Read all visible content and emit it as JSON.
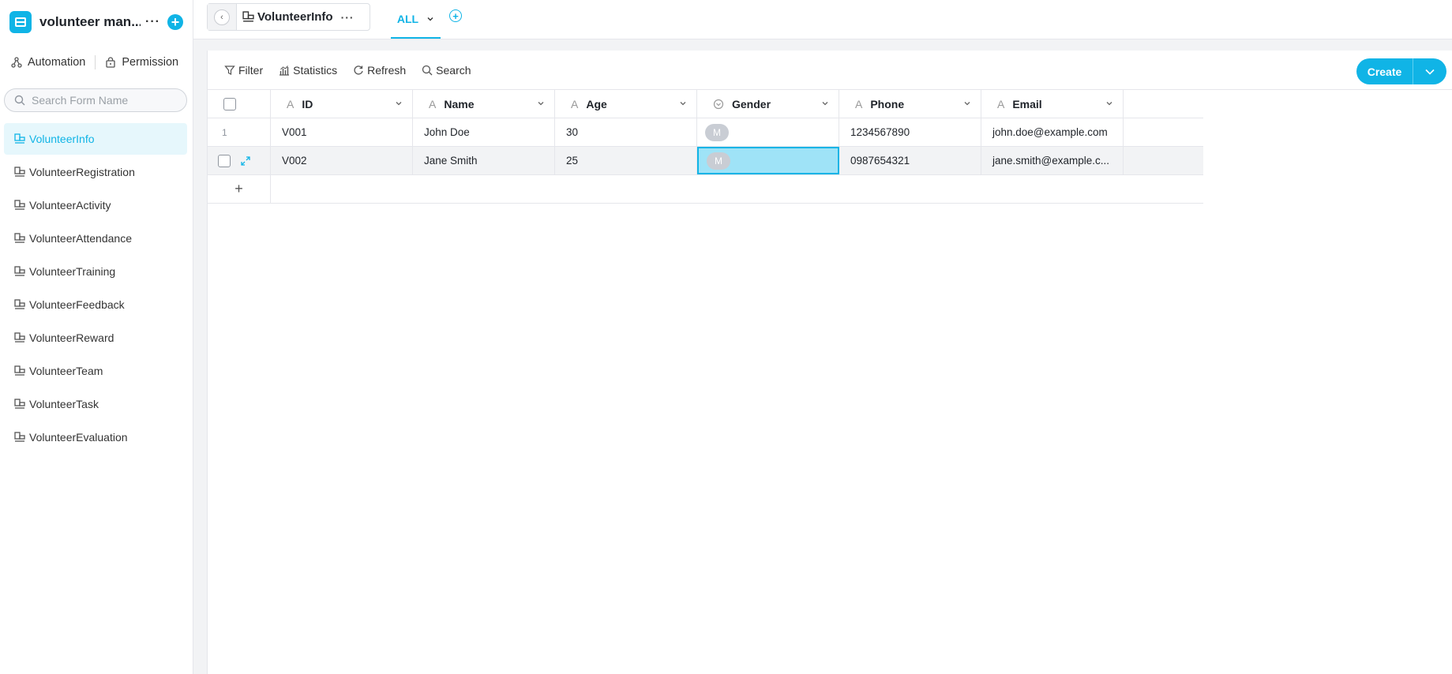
{
  "app": {
    "name": "volunteer man...",
    "more_glyph": "···",
    "add_glyph": "+"
  },
  "sidebar": {
    "automation_label": "Automation",
    "permission_label": "Permission",
    "search_placeholder": "Search Form Name",
    "forms": [
      {
        "label": "VolunteerInfo",
        "active": true
      },
      {
        "label": "VolunteerRegistration"
      },
      {
        "label": "VolunteerActivity"
      },
      {
        "label": "VolunteerAttendance"
      },
      {
        "label": "VolunteerTraining"
      },
      {
        "label": "VolunteerFeedback"
      },
      {
        "label": "VolunteerReward"
      },
      {
        "label": "VolunteerTeam"
      },
      {
        "label": "VolunteerTask"
      },
      {
        "label": "VolunteerEvaluation"
      }
    ]
  },
  "header": {
    "table_title": "VolunteerInfo",
    "more_glyph": "···",
    "view_tab": "ALL",
    "add_view_glyph": "+"
  },
  "toolbar": {
    "filter": "Filter",
    "statistics": "Statistics",
    "refresh": "Refresh",
    "search": "Search",
    "create": "Create"
  },
  "table": {
    "columns": [
      "ID",
      "Name",
      "Age",
      "Gender",
      "Phone",
      "Email"
    ],
    "rows": [
      {
        "num": "1",
        "ID": "V001",
        "Name": "John Doe",
        "Age": "30",
        "Gender": "M",
        "Phone": "1234567890",
        "Email": "john.doe@example.com"
      },
      {
        "num": "",
        "ID": "V002",
        "Name": "Jane Smith",
        "Age": "25",
        "Gender": "M",
        "Phone": "0987654321",
        "Email": "jane.smith@example.c..."
      }
    ],
    "add_row_glyph": "+"
  },
  "colors": {
    "accent": "#10b4e6",
    "active_bg": "#e6f7fc",
    "selected_cell": "#9fe3f7"
  },
  "icons": {
    "field_type_text": "A"
  }
}
